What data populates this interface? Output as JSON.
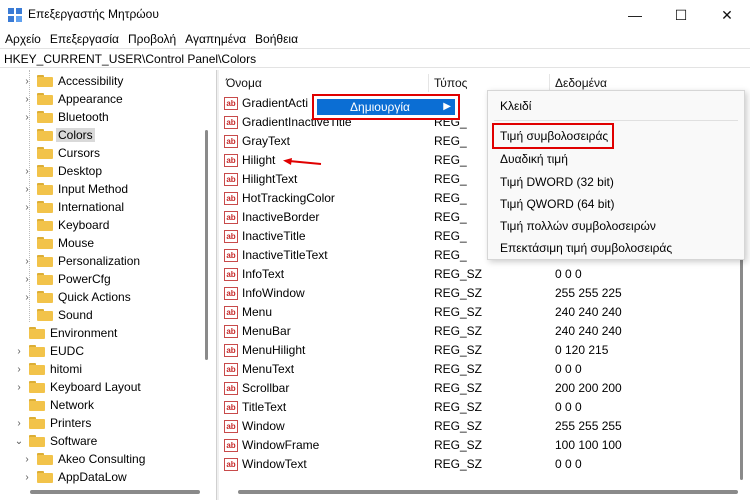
{
  "window": {
    "title": "Επεξεργαστής Μητρώου",
    "minimize": "—",
    "maximize": "☐",
    "close": "✕"
  },
  "menubar": [
    "Αρχείο",
    "Επεξεργασία",
    "Προβολή",
    "Αγαπημένα",
    "Βοήθεια"
  ],
  "address": "HKEY_CURRENT_USER\\Control Panel\\Colors",
  "tree": {
    "items": [
      {
        "label": "Accessibility",
        "indent": 1,
        "expandable": true
      },
      {
        "label": "Appearance",
        "indent": 1,
        "expandable": true
      },
      {
        "label": "Bluetooth",
        "indent": 1,
        "expandable": true
      },
      {
        "label": "Colors",
        "indent": 1,
        "expandable": false,
        "selected": true
      },
      {
        "label": "Cursors",
        "indent": 1,
        "expandable": false
      },
      {
        "label": "Desktop",
        "indent": 1,
        "expandable": true
      },
      {
        "label": "Input Method",
        "indent": 1,
        "expandable": true
      },
      {
        "label": "International",
        "indent": 1,
        "expandable": true
      },
      {
        "label": "Keyboard",
        "indent": 1,
        "expandable": false
      },
      {
        "label": "Mouse",
        "indent": 1,
        "expandable": false
      },
      {
        "label": "Personalization",
        "indent": 1,
        "expandable": true
      },
      {
        "label": "PowerCfg",
        "indent": 1,
        "expandable": true
      },
      {
        "label": "Quick Actions",
        "indent": 1,
        "expandable": true
      },
      {
        "label": "Sound",
        "indent": 1,
        "expandable": false
      },
      {
        "label": "Environment",
        "indent": 0,
        "expandable": false
      },
      {
        "label": "EUDC",
        "indent": 0,
        "expandable": true
      },
      {
        "label": "hitomi",
        "indent": 0,
        "expandable": true
      },
      {
        "label": "Keyboard Layout",
        "indent": 0,
        "expandable": true
      },
      {
        "label": "Network",
        "indent": 0,
        "expandable": false
      },
      {
        "label": "Printers",
        "indent": 0,
        "expandable": true
      },
      {
        "label": "Software",
        "indent": 0,
        "expandable": true,
        "expanded": true
      },
      {
        "label": "Akeo Consulting",
        "indent": 1,
        "expandable": true
      },
      {
        "label": "AppDataLow",
        "indent": 1,
        "expandable": true
      }
    ]
  },
  "list": {
    "headers": {
      "name": "Όνομα",
      "type": "Τύπος",
      "data": "Δεδομένα"
    },
    "icon_text": "ab",
    "rows": [
      {
        "name": "GradientActi",
        "type": "",
        "data": ""
      },
      {
        "name": "GradientInactiveTitle",
        "type": "REG_",
        "data": ""
      },
      {
        "name": "GrayText",
        "type": "REG_",
        "data": ""
      },
      {
        "name": "Hilight",
        "type": "REG_",
        "data": ""
      },
      {
        "name": "HilightText",
        "type": "REG_",
        "data": ""
      },
      {
        "name": "HotTrackingColor",
        "type": "REG_",
        "data": ""
      },
      {
        "name": "InactiveBorder",
        "type": "REG_",
        "data": ""
      },
      {
        "name": "InactiveTitle",
        "type": "REG_",
        "data": ""
      },
      {
        "name": "InactiveTitleText",
        "type": "REG_",
        "data": ""
      },
      {
        "name": "InfoText",
        "type": "REG_SZ",
        "data": "0 0 0"
      },
      {
        "name": "InfoWindow",
        "type": "REG_SZ",
        "data": "255 255 225"
      },
      {
        "name": "Menu",
        "type": "REG_SZ",
        "data": "240 240 240"
      },
      {
        "name": "MenuBar",
        "type": "REG_SZ",
        "data": "240 240 240"
      },
      {
        "name": "MenuHilight",
        "type": "REG_SZ",
        "data": "0 120 215"
      },
      {
        "name": "MenuText",
        "type": "REG_SZ",
        "data": "0 0 0"
      },
      {
        "name": "Scrollbar",
        "type": "REG_SZ",
        "data": "200 200 200"
      },
      {
        "name": "TitleText",
        "type": "REG_SZ",
        "data": "0 0 0"
      },
      {
        "name": "Window",
        "type": "REG_SZ",
        "data": "255 255 255"
      },
      {
        "name": "WindowFrame",
        "type": "REG_SZ",
        "data": "100 100 100"
      },
      {
        "name": "WindowText",
        "type": "REG_SZ",
        "data": "0 0 0"
      }
    ]
  },
  "context_menu": {
    "new_label": "Δημιουργία",
    "submenu": [
      "Κλειδί",
      "Τιμή συμβολοσειράς",
      "Δυαδική τιμή",
      "Τιμή DWORD (32 bit)",
      "Τιμή QWORD (64 bit)",
      "Τιμή πολλών συμβολοσειρών",
      "Επεκτάσιμη τιμή συμβολοσειράς"
    ]
  },
  "colors": {
    "highlight_blue": "#0b6ed4",
    "annotation_red": "#e00000",
    "folder_yellow": "#f2c34a"
  }
}
